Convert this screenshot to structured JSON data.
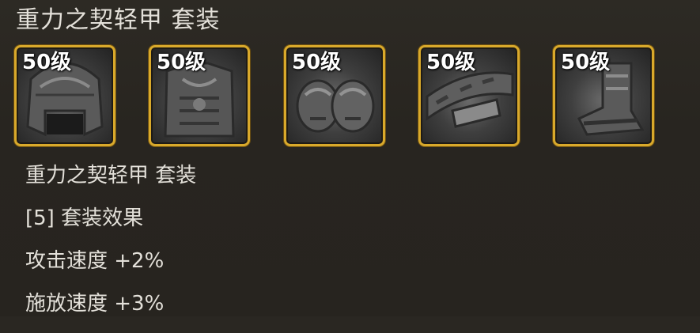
{
  "title": "重力之契轻甲 套装",
  "slots": [
    {
      "level": "50级",
      "icon": "helmet-icon"
    },
    {
      "level": "50级",
      "icon": "chest-armor-icon"
    },
    {
      "level": "50级",
      "icon": "shoulder-armor-icon"
    },
    {
      "level": "50级",
      "icon": "belt-icon"
    },
    {
      "level": "50级",
      "icon": "boots-icon"
    }
  ],
  "set_info": {
    "name": "重力之契轻甲 套装",
    "effect_header": "[5] 套装效果",
    "stats": [
      "攻击速度 +2%",
      "施放速度 +3%"
    ]
  },
  "colors": {
    "frame": "#d9a92b",
    "background": "#2a2722",
    "text": "#e4e1da"
  }
}
